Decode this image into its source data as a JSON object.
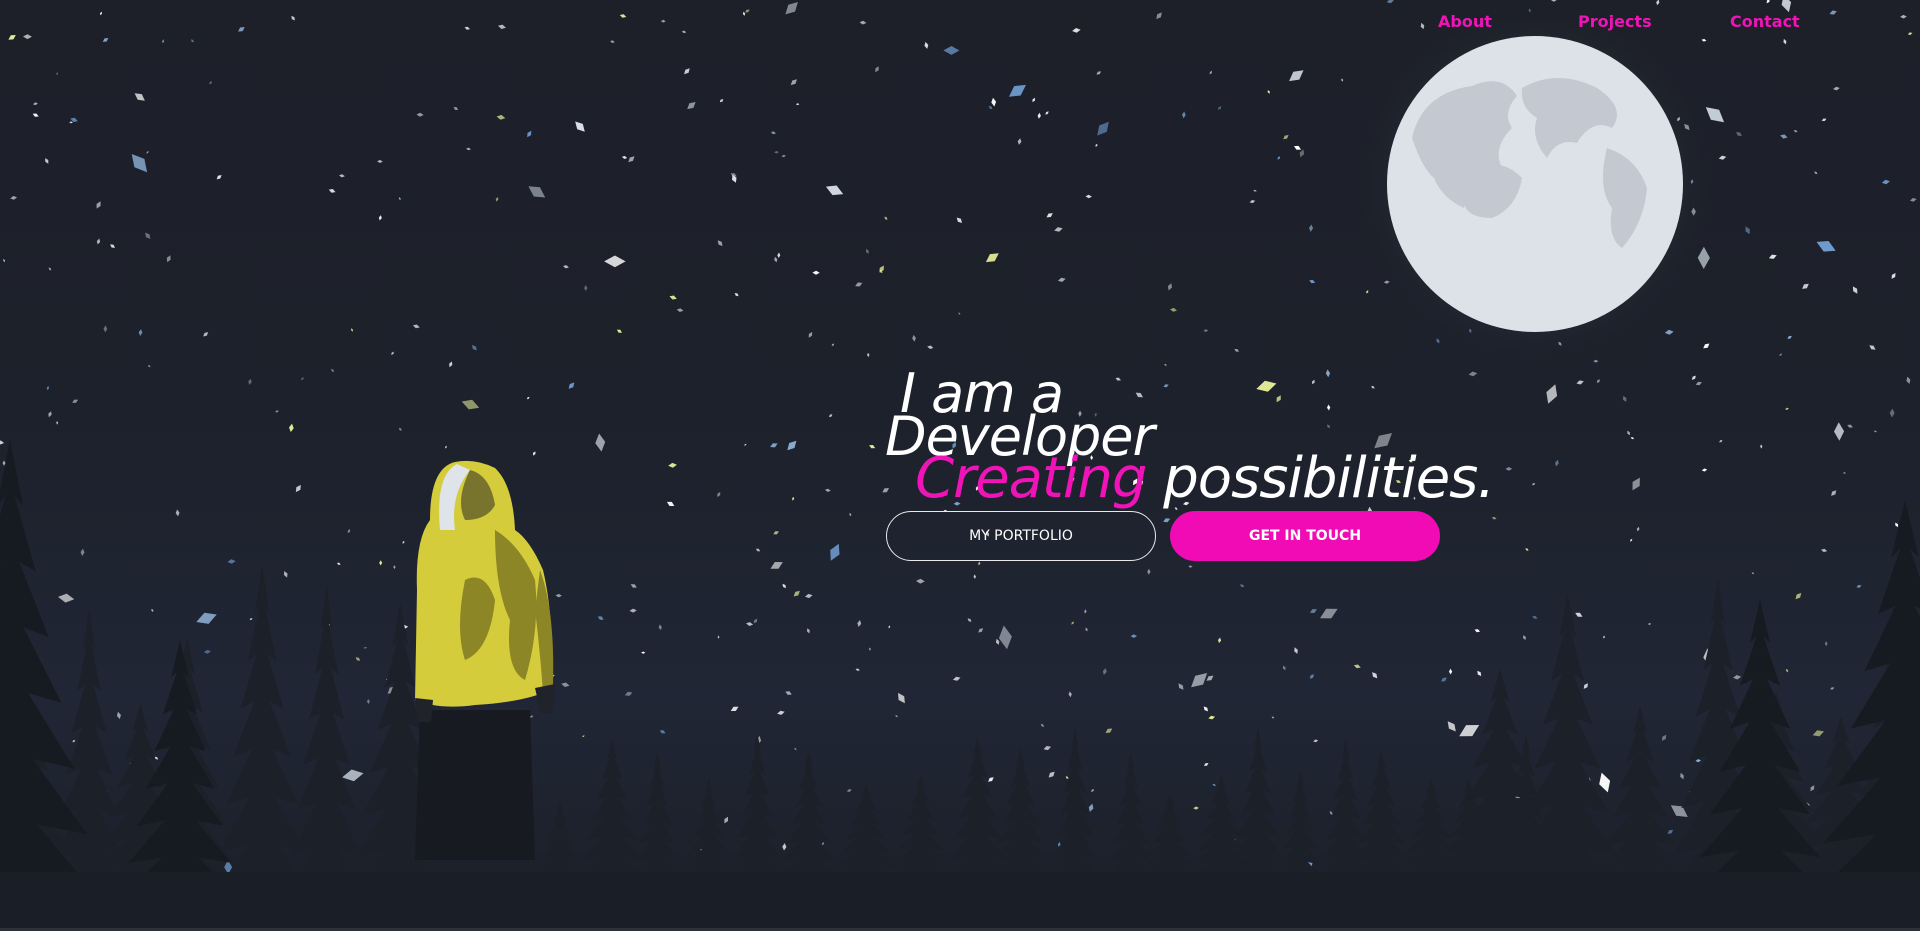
{
  "nav": {
    "about": "About",
    "projects": "Projects",
    "contact": "Contact"
  },
  "hero": {
    "line1": "I am a",
    "line2": "Developer",
    "line3_accent": "Creating",
    "line3_rest": " possibilities."
  },
  "buttons": {
    "portfolio": "MY PORTFOLIO",
    "contact": "GET IN TOUCH"
  },
  "colors": {
    "accent": "#f013b8",
    "background": "#1d212b",
    "moon": "#dde1e8",
    "hoodie": "#d4cc3a"
  }
}
